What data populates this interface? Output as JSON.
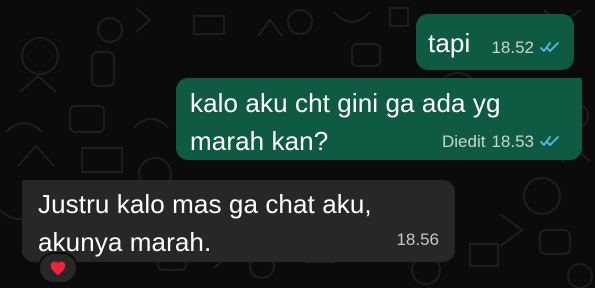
{
  "chat": {
    "messages": [
      {
        "direction": "outgoing",
        "text": "tapi",
        "time": "18.52",
        "status": "read",
        "edited_label": ""
      },
      {
        "direction": "outgoing",
        "text": "kalo aku cht gini ga ada yg marah kan?",
        "time": "18.53",
        "status": "read",
        "edited_label": "Diedit"
      },
      {
        "direction": "incoming",
        "text": "Justru kalo mas ga chat aku, akunya marah.",
        "time": "18.56",
        "reaction": "❤️"
      }
    ]
  },
  "theme": {
    "background": "#0b0b0c",
    "outgoing_bubble": "#0f5a43",
    "incoming_bubble": "#262727",
    "read_ticks": "#53bdeb"
  }
}
